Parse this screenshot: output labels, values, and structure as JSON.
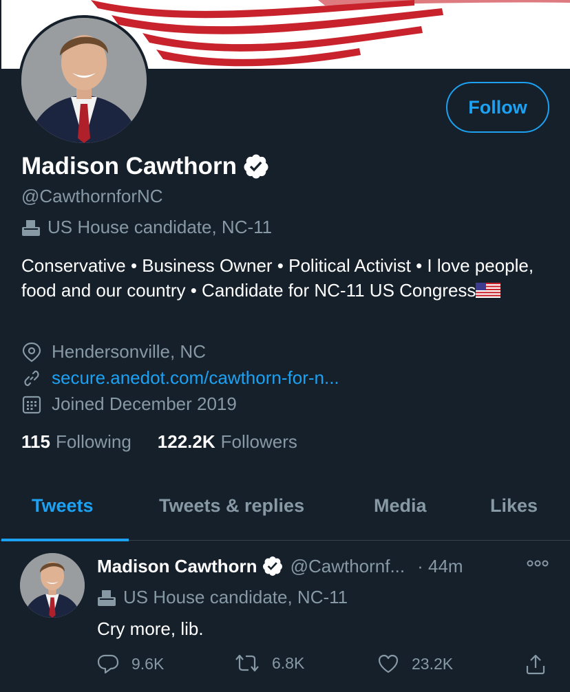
{
  "profile": {
    "display_name": "Madison Cawthorn",
    "handle": "@CawthornforNC",
    "category": "US House candidate, NC-11",
    "bio": "Conservative • Business Owner • Political Activist • I love people, food and our country • Candidate for NC-11 US Congress",
    "bio_emoji": "us-flag",
    "location": "Hendersonville, NC",
    "website": "secure.anedot.com/cawthorn-for-n...",
    "joined": "Joined December 2019",
    "following_count": "115",
    "following_label": "Following",
    "followers_count": "122.2K",
    "followers_label": "Followers",
    "follow_button_label": "Follow"
  },
  "tabs": [
    {
      "label": "Tweets",
      "active": true
    },
    {
      "label": "Tweets & replies",
      "active": false
    },
    {
      "label": "Media",
      "active": false
    },
    {
      "label": "Likes",
      "active": false
    }
  ],
  "tweet": {
    "author_name": "Madison Cawthorn",
    "author_handle": "@Cawthornf...",
    "time": "· 44m",
    "category": "US House candidate, NC-11",
    "text": "Cry more, lib.",
    "reply_count": "9.6K",
    "retweet_count": "6.8K",
    "like_count": "23.2K"
  },
  "colors": {
    "background": "#15202b",
    "accent": "#1da1f2",
    "secondary_text": "#8899a6",
    "divider": "#38444d",
    "banner_red": "#c8232c"
  },
  "icons": {
    "verified": "verified-badge-icon",
    "category": "ballot-box-icon",
    "location": "location-pin-icon",
    "link": "link-icon",
    "calendar": "calendar-icon",
    "more": "more-dots-icon",
    "reply": "reply-icon",
    "retweet": "retweet-icon",
    "like": "heart-icon",
    "share": "share-icon"
  }
}
